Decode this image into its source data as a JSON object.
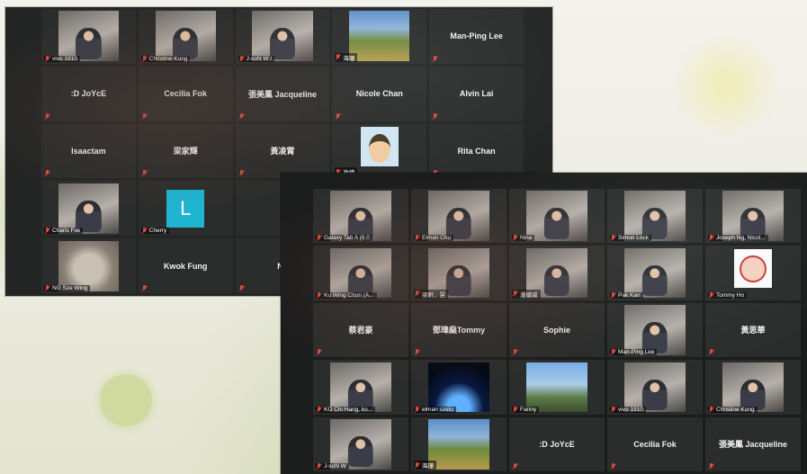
{
  "screen1": {
    "tiles": [
      {
        "name": "vivo 1910",
        "kind": "video"
      },
      {
        "name": "Christine Kong",
        "kind": "video"
      },
      {
        "name": "J-soN W /",
        "kind": "video"
      },
      {
        "name": "海珊",
        "kind": "scenic"
      },
      {
        "name": "Man-Ping Lee",
        "kind": "name"
      },
      {
        "name": ":D JoYcE",
        "kind": "name"
      },
      {
        "name": "Cecilia Fok",
        "kind": "name"
      },
      {
        "name": "張美鳳 Jacqueline",
        "kind": "name"
      },
      {
        "name": "Nicole Chan",
        "kind": "name"
      },
      {
        "name": "Alvin Lai",
        "kind": "name"
      },
      {
        "name": "Isaactam",
        "kind": "name"
      },
      {
        "name": "梁家輝",
        "kind": "name"
      },
      {
        "name": "黃凌霄",
        "kind": "name"
      },
      {
        "name": "政德",
        "kind": "cartoon"
      },
      {
        "name": "Rita Chan",
        "kind": "name"
      },
      {
        "name": "Charis Fok",
        "kind": "video"
      },
      {
        "name": "Cherry",
        "kind": "letter",
        "letter": "L"
      },
      {
        "name": "",
        "kind": "blank"
      },
      {
        "name": "",
        "kind": "blank"
      },
      {
        "name": "",
        "kind": "blank"
      },
      {
        "name": "NG Sze Wing",
        "kind": "cat"
      },
      {
        "name": "Kwok Fung",
        "kind": "name"
      },
      {
        "name": "Ne",
        "kind": "name"
      },
      {
        "name": "",
        "kind": "blank"
      },
      {
        "name": "",
        "kind": "blank"
      }
    ]
  },
  "screen2": {
    "tiles": [
      {
        "name": "Galaxy Tab A (8.0",
        "kind": "video"
      },
      {
        "name": "Elman Chu",
        "kind": "video"
      },
      {
        "name": "Nina",
        "kind": "video"
      },
      {
        "name": "Simon Lock",
        "kind": "video"
      },
      {
        "name": "Joseph Ng, Nicol...",
        "kind": "video"
      },
      {
        "name": "Ku Wing Chun (A...",
        "kind": "video"
      },
      {
        "name": "梁軒．慧",
        "kind": "video"
      },
      {
        "name": "潘健威",
        "kind": "video"
      },
      {
        "name": "Pak Kan",
        "kind": "video"
      },
      {
        "name": "Tommy Ho",
        "kind": "face"
      },
      {
        "name": "蔡君豪",
        "kind": "name"
      },
      {
        "name": "鄧瑋燊Tommy",
        "kind": "name"
      },
      {
        "name": "Sophie",
        "kind": "name"
      },
      {
        "name": "Man-Ping Lee",
        "kind": "video"
      },
      {
        "name": "黃思華",
        "kind": "name"
      },
      {
        "name": "KO Chi Hang, ko...",
        "kind": "video"
      },
      {
        "name": "elman szeto",
        "kind": "space"
      },
      {
        "name": "Fanny",
        "kind": "mountain"
      },
      {
        "name": "vivo 1910",
        "kind": "video"
      },
      {
        "name": "Christine Kong",
        "kind": "video"
      },
      {
        "name": "J-soN W",
        "kind": "video"
      },
      {
        "name": "海珊",
        "kind": "scenic"
      },
      {
        "name": ":D JoYcE",
        "kind": "name"
      },
      {
        "name": "Cecilia Fok",
        "kind": "name"
      },
      {
        "name": "張美鳳 Jacqueline",
        "kind": "name"
      }
    ]
  }
}
